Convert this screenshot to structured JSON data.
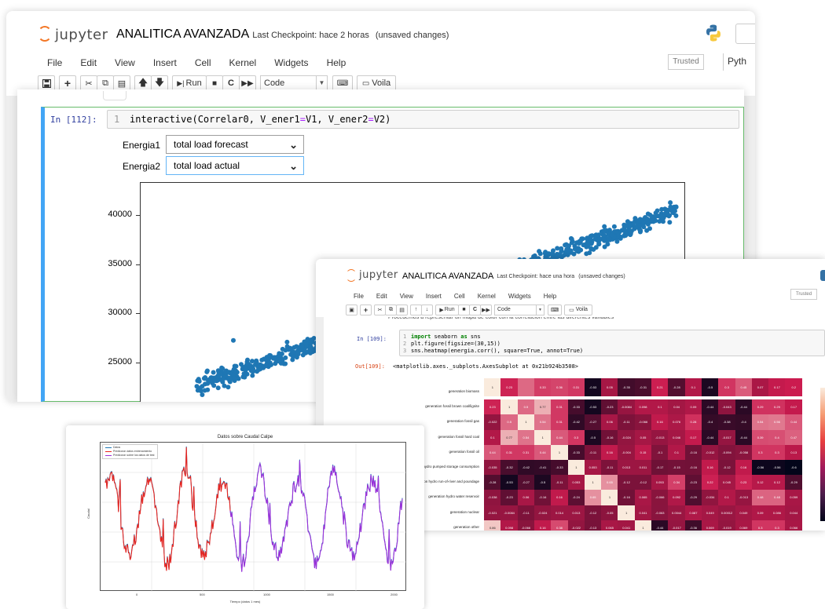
{
  "main": {
    "logo_word": "jupyter",
    "notebook_title": "ANALITICA AVANZADA",
    "checkpoint": "Last Checkpoint: hace 2 horas",
    "unsaved": "(unsaved changes)",
    "menu": [
      "File",
      "Edit",
      "View",
      "Insert",
      "Cell",
      "Kernel",
      "Widgets",
      "Help"
    ],
    "trusted": "Trusted",
    "kernel": "Pyth",
    "toolbar": {
      "run": "Run",
      "celltype": "Code",
      "voila": "Voila"
    },
    "cell": {
      "prompt": "In [112]:",
      "line_no": "1",
      "code_prefix": "interactive(Correlar0, V_ener1",
      "code_eq1": "=",
      "code_mid": "V1, V_ener2",
      "code_eq2": "=",
      "code_suffix": "V2)"
    },
    "widgets": [
      {
        "label": "Energia1",
        "value": "total load forecast"
      },
      {
        "label": "Energia2",
        "value": "total load actual"
      }
    ],
    "colors": {
      "accent": "#42a5f5",
      "scatter": "#1f77b4",
      "logo": "#f37726"
    }
  },
  "second": {
    "logo_word": "jupyter",
    "notebook_title": "ANALITICA AVANZADA",
    "checkpoint": "Last Checkpoint: hace una hora",
    "unsaved": "(unsaved changes)",
    "menu": [
      "File",
      "Edit",
      "View",
      "Insert",
      "Cell",
      "Kernel",
      "Widgets",
      "Help"
    ],
    "trusted": "Trusted",
    "toolbar": {
      "run": "Run",
      "celltype": "Code",
      "voila": "Voila"
    },
    "truncated_text": "Procedemos a representar un mapa de color con la correlacion entre las diferentes variables",
    "cell": {
      "prompt": "In [109]:",
      "lines": [
        {
          "n": "1",
          "kw": "import",
          "rest1": " seaborn ",
          "kw2": "as",
          "rest2": " sns"
        },
        {
          "n": "2",
          "plain": "plt.figure(figsize=(30,15))"
        },
        {
          "n": "3",
          "plain": "sns.heatmap(energia.corr(), square=True, annot=True)"
        }
      ],
      "out_prompt": "Out[109]:",
      "out_text": "<matplotlib.axes._subplots.AxesSubplot at 0x21b924b3508>"
    }
  },
  "chart_data": [
    {
      "type": "scatter",
      "title": "",
      "xlabel": "",
      "ylabel": "",
      "yticks": [
        "40000",
        "35000",
        "30000",
        "25000"
      ],
      "ylim": [
        21000,
        41500
      ],
      "grid": false,
      "color": "#1f77b4",
      "trend": {
        "x_start": 0.12,
        "y_start": 22500,
        "x_end": 1.0,
        "y_end": 40500,
        "spread": 1400
      },
      "outliers": [
        {
          "x": 0.17,
          "y": 27300
        }
      ]
    },
    {
      "type": "heatmap",
      "labels": [
        "generation biomass",
        "generation fossil brown coal/lignite",
        "generation fossil gas",
        "generation fossil hard coal",
        "generation fossil oil",
        "generation hydro pumped storage consumption",
        "generation hydro run-of-river and poundage",
        "generation hydro water reservoir",
        "generation nuclear",
        "generation other"
      ],
      "rows": [
        [
          "1",
          "0.23",
          "",
          "0.33",
          "0.36",
          "0.31",
          "-0.53",
          "0.05",
          "-0.35",
          "-0.31",
          "0.21",
          "-0.28",
          "0.1",
          "-0.5",
          "0.3",
          "0.45",
          "0.07",
          "0.17",
          "0.2"
        ],
        [
          "0.23",
          "1",
          "0.5",
          "0.77",
          "0.31",
          "-0.33",
          "-0.53",
          "-0.23",
          "-0.0084",
          "0.098",
          "0.1",
          "0.04",
          "0.09",
          "-0.44",
          "-0.043",
          "-0.44",
          "0.29",
          "0.29",
          "0.17"
        ],
        [
          "-0.022",
          "0.5",
          "1",
          "0.54",
          "0.31",
          "-0.42",
          "-0.27",
          "0.06",
          "-0.11",
          "-0.066",
          "0.16",
          "0.076",
          "0.28",
          "-0.4",
          "-0.38",
          "-0.4",
          "0.54",
          "0.56",
          "0.44"
        ],
        [
          "0.1",
          "0.77",
          "0.54",
          "1",
          "0.44",
          "0.3",
          "-0.5",
          "-0.16",
          "-0.024",
          "0.05",
          "-0.013",
          "0.046",
          "0.17",
          "-0.44",
          "-0.017",
          "-0.44",
          "0.39",
          "0.4",
          "0.47"
        ],
        [
          "0.44",
          "0.31",
          "0.31",
          "0.44",
          "1",
          "-0.33",
          "-0.11",
          "0.16",
          "-0.004",
          "0.15",
          "-0.1",
          "0.1",
          "-0.16",
          "-0.012",
          "-0.094",
          "-0.058",
          "0.3",
          "0.3",
          "0.13"
        ],
        [
          "-0.035",
          "-0.32",
          "-0.42",
          "-0.41",
          "-0.33",
          "1",
          "0.053",
          "-0.11",
          "0.013",
          "0.011",
          "-0.17",
          "-0.15",
          "-0.16",
          "0.16",
          "-0.12",
          "0.16",
          "-0.56",
          "-0.56",
          "-0.6"
        ],
        [
          "-0.28",
          "-0.53",
          "-0.27",
          "-0.5",
          "-0.11",
          "0.053",
          "1",
          "0.65",
          "-0.12",
          "-0.12",
          "0.053",
          "0.34",
          "-0.23",
          "0.22",
          "0.045",
          "0.23",
          "0.12",
          "0.12",
          "-0.29"
        ],
        [
          "-0.038",
          "-0.23",
          "0.06",
          "-0.16",
          "0.16",
          "-0.24",
          "0.65",
          "1",
          "-0.16",
          "0.065",
          "-0.066",
          "0.092",
          "-0.29",
          "-0.034",
          "0.1",
          "-0.013",
          "0.48",
          "0.48",
          "0.059"
        ],
        [
          "-0.021",
          "-0.0084",
          "-0.11",
          "-0.024",
          "0.014",
          "0.013",
          "-0.12",
          "-0.05",
          "1",
          "0.041",
          "-0.063",
          "0.0044",
          "0.087",
          "0.049",
          "0.00012",
          "0.049",
          "0.09",
          "0.086",
          "0.044"
        ],
        [
          "0.86",
          "0.098",
          "-0.066",
          "0.16",
          "0.38",
          "-0.022",
          "-0.13",
          "0.065",
          "0.041",
          "1",
          "-0.44",
          "-0.017",
          "-0.36",
          "0.069",
          "-0.019",
          "0.069",
          "0.3",
          "0.3",
          "0.066"
        ]
      ],
      "color_low": "#03051a",
      "color_mid": "#cb1b4f",
      "color_high": "#faebdd",
      "partial_top_cell": "0.45"
    },
    {
      "type": "line",
      "title": "Datos sobre Caudal Calpe",
      "xlabel": "Tiempo (datos 1 mes)",
      "ylabel": "Caudal",
      "xticks": [
        "0",
        "500",
        "1000",
        "1500",
        "2000"
      ],
      "legend": [
        "Datos",
        "Prediccion datos entrenamiento",
        "Prediccion sobre los datos de test"
      ],
      "legend_position": "top-left",
      "grid": true,
      "series": [
        {
          "name": "Datos",
          "color": "#1f77b4"
        },
        {
          "name": "Prediccion datos entrenamiento",
          "color": "#e8241f"
        },
        {
          "name": "Prediccion sobre los datos de test",
          "color": "#9b30d9"
        }
      ],
      "periods": 8,
      "split_fraction": 0.42
    }
  ]
}
